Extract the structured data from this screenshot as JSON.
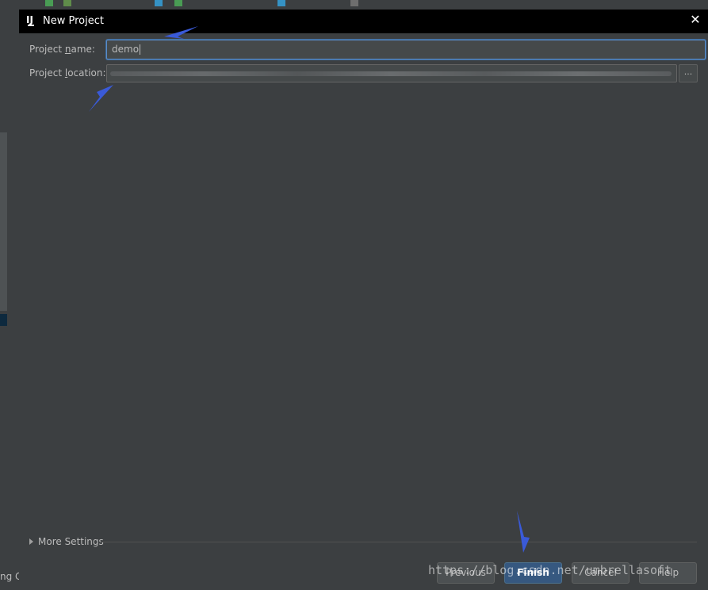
{
  "ide": {
    "status_fragment": "ng C"
  },
  "dialog": {
    "title": "New Project",
    "app_icon_text": "IJ",
    "project_name": {
      "label_pre": "Project ",
      "label_mnemonic": "n",
      "label_post": "ame:",
      "value": "demo"
    },
    "project_location": {
      "label_pre": "Project ",
      "label_mnemonic": "l",
      "label_post": "ocation:",
      "browse_label": "..."
    },
    "more_settings": {
      "label": "More Settings"
    },
    "buttons": {
      "previous": "Previous",
      "finish": "Finish",
      "cancel": "Cancel",
      "help": "Help"
    }
  },
  "watermark": "https://blog.csdn.net/umbrellasoft",
  "colors": {
    "background": "#3c3f41",
    "titlebar": "#000000",
    "accent_focus": "#5a8bc8",
    "primary_button": "#365880",
    "annotation_arrow": "#3a5ad8"
  }
}
